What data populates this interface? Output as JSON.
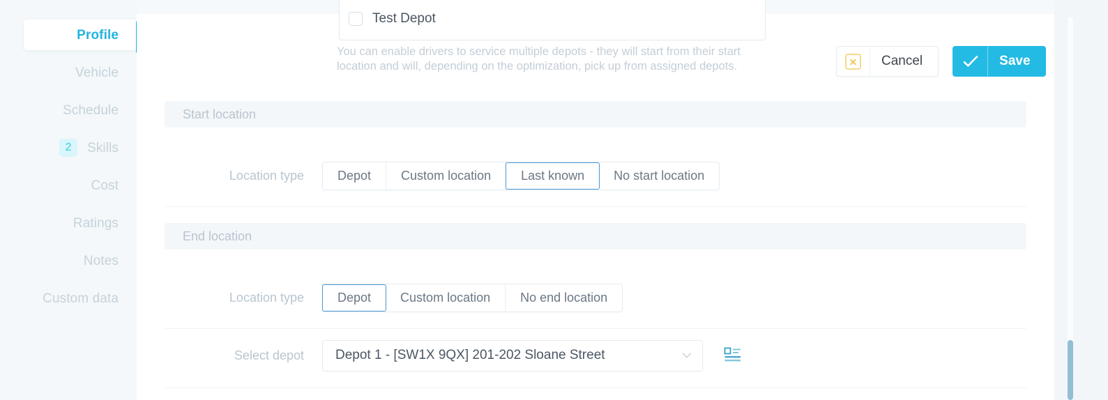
{
  "sidebar": {
    "items": [
      {
        "label": "Profile",
        "active": true,
        "badge": null
      },
      {
        "label": "Vehicle",
        "active": false,
        "badge": null
      },
      {
        "label": "Schedule",
        "active": false,
        "badge": null
      },
      {
        "label": "Skills",
        "active": false,
        "badge": "2"
      },
      {
        "label": "Cost",
        "active": false,
        "badge": null
      },
      {
        "label": "Ratings",
        "active": false,
        "badge": null
      },
      {
        "label": "Notes",
        "active": false,
        "badge": null
      },
      {
        "label": "Custom data",
        "active": false,
        "badge": null
      }
    ]
  },
  "depot_multiselect": {
    "option_label": "Test Depot",
    "checked": false
  },
  "hint": {
    "line1": "You can enable drivers to service multiple depots - they will start from their start",
    "line2": "location and will, depending on the optimization, pick up from assigned depots."
  },
  "actions": {
    "cancel_label": "Cancel",
    "cancel_icon": "x-square-icon",
    "save_label": "Save",
    "save_icon": "check-icon"
  },
  "start_location": {
    "section_title": "Start location",
    "row_label": "Location type",
    "options": [
      {
        "label": "Depot",
        "selected": false
      },
      {
        "label": "Custom location",
        "selected": false
      },
      {
        "label": "Last known",
        "selected": true
      },
      {
        "label": "No start location",
        "selected": false
      }
    ]
  },
  "end_location": {
    "section_title": "End location",
    "row_label": "Location type",
    "options": [
      {
        "label": "Depot",
        "selected": true
      },
      {
        "label": "Custom location",
        "selected": false
      },
      {
        "label": "No end location",
        "selected": false
      }
    ],
    "select_depot": {
      "row_label": "Select depot",
      "value": "Depot 1 - [SW1X 9QX] 201-202 Sloane Street",
      "chevron_icon": "chevron-down-icon",
      "side_icon": "depot-list-icon"
    }
  },
  "colors": {
    "accent": "#23bae3",
    "selected_border": "#4a97d2",
    "badge_bg": "#d8f6fb",
    "badge_text": "#3ccbe6",
    "cancel_icon": "#f0c75a",
    "scrollbar_thumb": "#92bed6",
    "section_bar_bg": "#f3f7fa",
    "muted_text": "#b9c5cf"
  }
}
